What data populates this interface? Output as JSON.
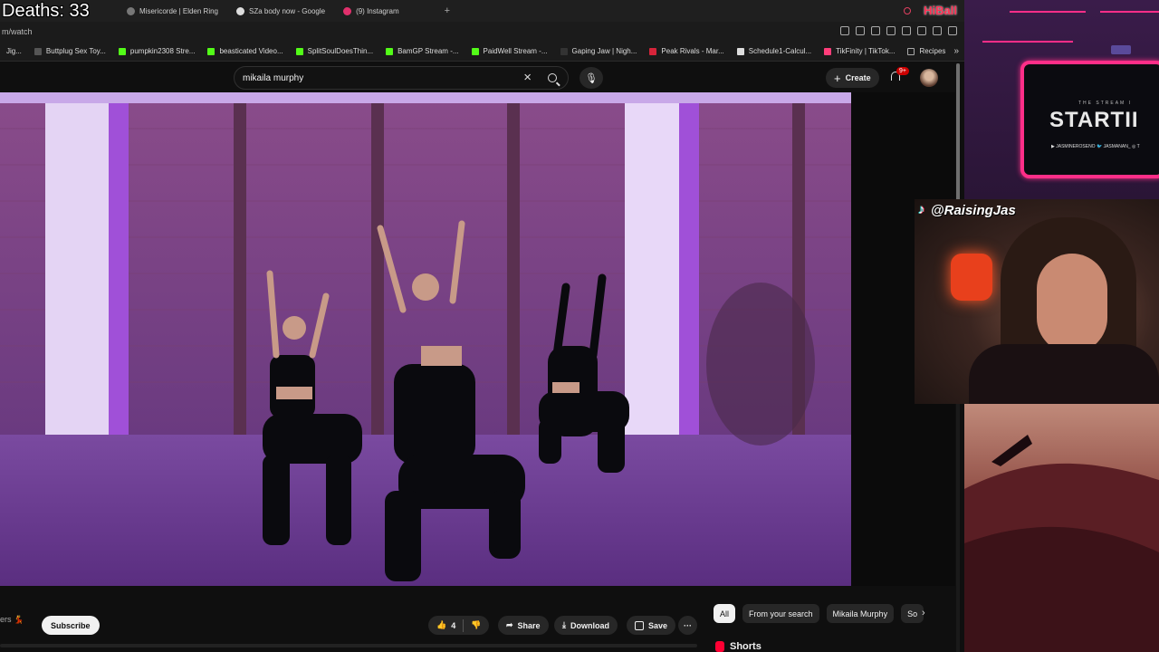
{
  "overlay_counter": {
    "deaths": "Deaths: 33"
  },
  "tabs": [
    {
      "label": "Misericorde | Elden Ring",
      "color": "#777777"
    },
    {
      "label": "SZa body now - Google",
      "color": "#dddddd"
    },
    {
      "label": "(9) Instagram",
      "color": "#e1306c"
    }
  ],
  "tabbar_brand": "HiBall",
  "address": {
    "url": "m/watch"
  },
  "bookmarks": [
    {
      "label": "Jig...",
      "color": "#555555"
    },
    {
      "label": "Buttplug Sex Toy...",
      "color": "#555555"
    },
    {
      "label": "pumpkin2308 Stre...",
      "color": "#53fc18"
    },
    {
      "label": "beasticated Video...",
      "color": "#53fc18"
    },
    {
      "label": "SplitSoulDoesThin...",
      "color": "#53fc18"
    },
    {
      "label": "BamGP Stream -...",
      "color": "#53fc18"
    },
    {
      "label": "PaidWell Stream -...",
      "color": "#53fc18"
    },
    {
      "label": "Gaping Jaw | Nigh...",
      "color": "#333333"
    },
    {
      "label": "Peak Rivals - Mar...",
      "color": "#d6243a"
    },
    {
      "label": "Schedule1-Calcul...",
      "color": "#dddddd"
    },
    {
      "label": "TikFinity | TikTok...",
      "color": "#ff3d7a"
    },
    {
      "label": "Recipes",
      "color": "#aaaaaa"
    }
  ],
  "youtube": {
    "search_query": "mikaila murphy",
    "create_label": "Create",
    "notification_count": "9+",
    "subscriber_suffix": "ers 💃",
    "subscribe_label": "Subscribe",
    "like_count": "4",
    "share_label": "Share",
    "download_label": "Download",
    "save_label": "Save",
    "more_label": "···",
    "chips": [
      {
        "label": "All",
        "active": true
      },
      {
        "label": "From your search",
        "active": false
      },
      {
        "label": "Mikaila Murphy",
        "active": false
      },
      {
        "label": "So",
        "active": false
      }
    ],
    "shorts_label": "Shorts"
  },
  "stream_overlay": {
    "tiktok_handle": "@RaisingJas",
    "screen_small": "THE STREAM I",
    "screen_big": "STARTII",
    "screen_handles": "▶ JASMINEROSENO   🐦 JASMANAN_   ◎ T"
  }
}
